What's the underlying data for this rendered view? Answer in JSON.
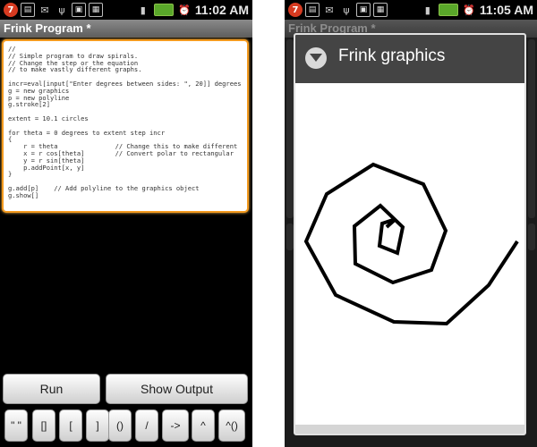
{
  "left": {
    "status_time": "11:02 AM",
    "badge_count": "7",
    "title": "Frink Program *",
    "code": "//\n// Simple program to draw spirals.\n// Change the step or the equation\n// to make vastly different graphs.\n\nincr=eval[input[\"Enter degrees between sides: \", 20]] degrees\ng = new graphics\np = new polyline\ng.stroke[2]\n\nextent = 10.1 circles\n\nfor theta = 0 degrees to extent step incr\n{\n    r = theta               // Change this to make different\n    x = r cos[theta]        // Convert polar to rectangular\n    y = r sin[theta]\n    p.addPoint[x, y]\n}\n\ng.add[p]    // Add polyline to the graphics object\ng.show[]",
    "buttons": {
      "run": "Run",
      "show_output": "Show Output"
    },
    "symbols": [
      "\" \"",
      "[]",
      "[",
      "]",
      "()",
      "/",
      "->",
      "^",
      "^()"
    ]
  },
  "right": {
    "status_time": "11:05 AM",
    "badge_count": "7",
    "background_title": "Frink Program *",
    "dialog_title": "Frink graphics"
  },
  "icons": {
    "status_left": [
      "notification-badge-icon",
      "clipboard-icon",
      "gmail-icon",
      "usb-icon",
      "usb-debug-icon",
      "app-icon"
    ],
    "status_right": [
      "signal-icon",
      "battery-icon",
      "alarm-icon"
    ],
    "dialog": "chevron-down-circle-icon"
  },
  "colors": {
    "editor_border": "#f39a1f",
    "title_bar": "#6e6e6e",
    "dialog_header": "#444444",
    "battery": "#5aa82a",
    "badge": "#d63a20"
  }
}
